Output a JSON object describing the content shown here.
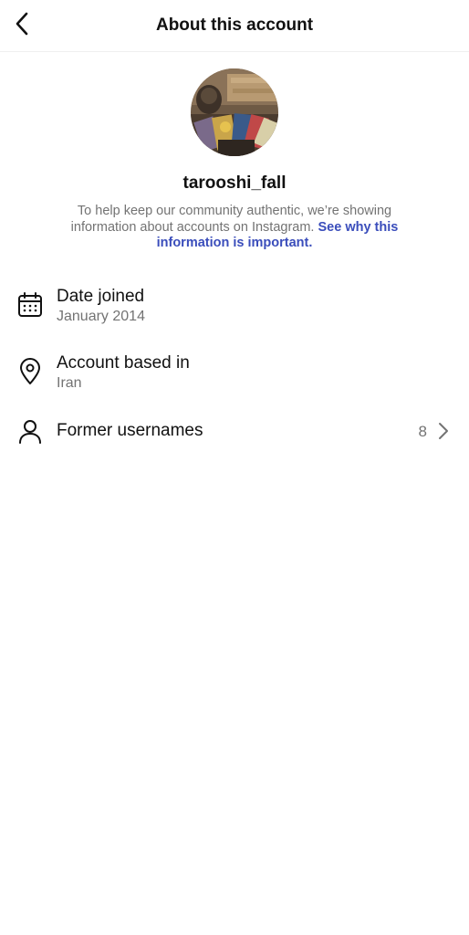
{
  "header": {
    "title": "About this account",
    "back_icon": "chevron-left-icon"
  },
  "profile": {
    "username": "tarooshi_fall",
    "info_text": "To help keep our community authentic, we’re showing information about accounts on Instagram.",
    "info_link": "See why this information is important."
  },
  "details": {
    "date_joined": {
      "icon": "calendar-icon",
      "label": "Date joined",
      "value": "January 2014"
    },
    "account_based_in": {
      "icon": "location-pin-icon",
      "label": "Account based in",
      "value": "Iran"
    },
    "former_usernames": {
      "icon": "person-icon",
      "label": "Former usernames",
      "count": "8",
      "chevron_icon": "chevron-right-icon"
    }
  },
  "colors": {
    "link": "#3a4dbb",
    "secondary_text": "#737373",
    "primary_text": "#111111",
    "divider": "#efefef"
  }
}
